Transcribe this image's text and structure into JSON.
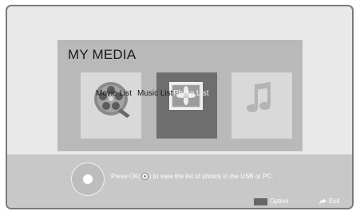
{
  "panel": {
    "title": "MY MEDIA"
  },
  "tiles": [
    {
      "id": "movie",
      "label": "Movie List",
      "icon": "film-reel-icon",
      "selected": false
    },
    {
      "id": "photo",
      "label": "Photo List",
      "icon": "photo-icon",
      "selected": true
    },
    {
      "id": "music",
      "label": "Music List",
      "icon": "music-note-icon",
      "selected": false
    }
  ],
  "info": {
    "text_before": "Press OK(",
    "text_after": ") to view the list of photos in the USB or PC.",
    "option_label": "Option",
    "exit_label": "Exit"
  },
  "colors": {
    "panel": "#b9b9b9",
    "tile": "#d9d9d9",
    "tile_selected": "#6e6e6e",
    "info_bar": "#c8c8c8"
  }
}
